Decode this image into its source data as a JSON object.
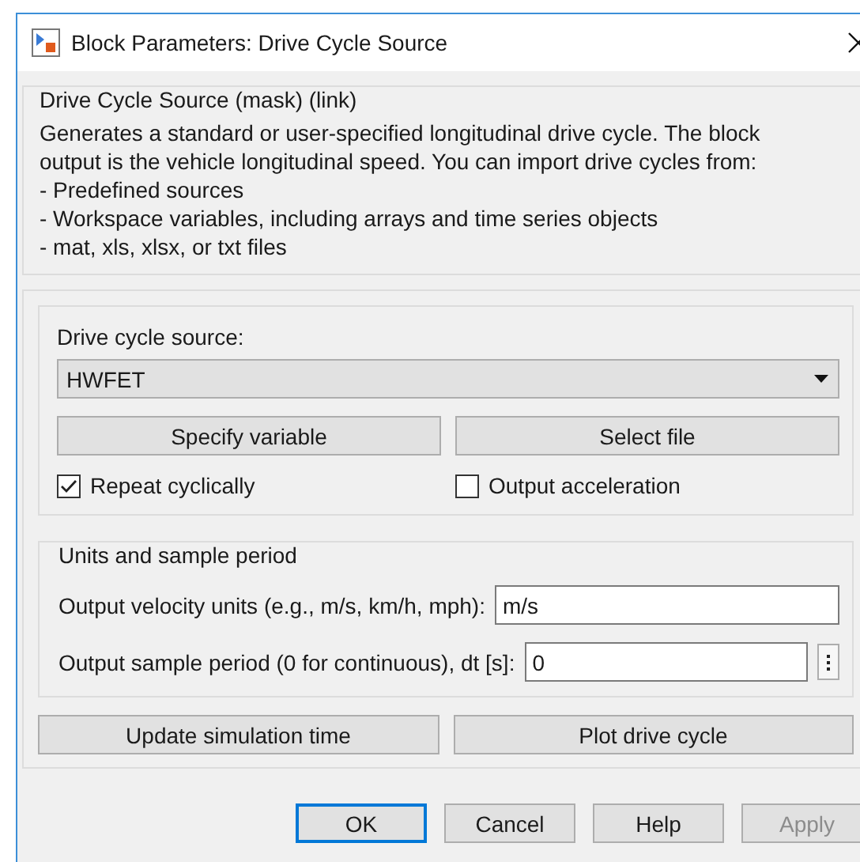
{
  "window": {
    "title": "Block Parameters: Drive Cycle Source"
  },
  "mask": {
    "title": "Drive Cycle Source (mask) (link)",
    "description": [
      "Generates a standard or user-specified longitudinal drive cycle. The block",
      "output is the vehicle longitudinal speed. You can import drive cycles from:",
      "- Predefined sources",
      "- Workspace variables, including arrays and time series objects",
      "- mat, xls, xlsx, or txt files"
    ]
  },
  "source": {
    "label": "Drive cycle source:",
    "value": "HWFET",
    "buttons": [
      "Specify variable",
      "Select file"
    ],
    "checkboxes": [
      {
        "label": "Repeat cyclically",
        "checked": true
      },
      {
        "label": "Output acceleration",
        "checked": false
      }
    ]
  },
  "units": {
    "title": "Units and sample period",
    "fields": [
      {
        "label": "Output velocity units (e.g., m/s, km/h, mph):",
        "value": "m/s",
        "kind": "plain"
      },
      {
        "label": "Output sample period (0 for continuous), dt [s]:",
        "value": "0",
        "kind": "menu"
      }
    ]
  },
  "actions": [
    "Update simulation time",
    "Plot drive cycle"
  ],
  "buttons": [
    {
      "label": "OK",
      "focused": true,
      "disabled": false
    },
    {
      "label": "Cancel",
      "focused": false,
      "disabled": false
    },
    {
      "label": "Help",
      "focused": false,
      "disabled": false
    },
    {
      "label": "Apply",
      "focused": false,
      "disabled": true
    }
  ]
}
